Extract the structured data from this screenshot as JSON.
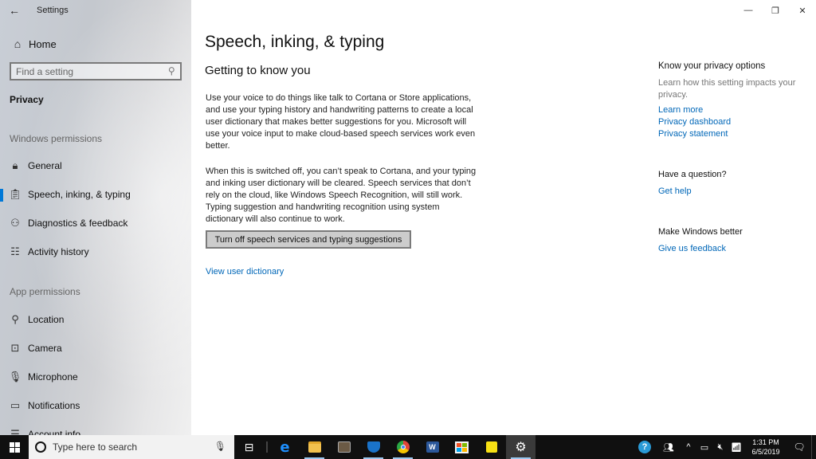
{
  "window": {
    "app_title": "Settings",
    "controls": {
      "minimize": "—",
      "restore": "❐",
      "close": "✕"
    }
  },
  "sidebar": {
    "back_icon": "←",
    "home": {
      "icon": "home-icon",
      "glyph": "⌂",
      "label": "Home"
    },
    "search": {
      "placeholder": "Find a setting",
      "value": "",
      "icon_glyph": "⚲"
    },
    "section_heading": "Privacy",
    "groups": [
      {
        "label": "Windows permissions",
        "items": [
          {
            "label": "General",
            "icon": "lock-icon",
            "glyph": "🔒︎",
            "selected": false
          },
          {
            "label": "Speech, inking, & typing",
            "icon": "clipboard-icon",
            "glyph": "📋︎",
            "selected": true
          },
          {
            "label": "Diagnostics & feedback",
            "icon": "person-feedback-icon",
            "glyph": "⚇",
            "selected": false
          },
          {
            "label": "Activity history",
            "icon": "timeline-icon",
            "glyph": "☷",
            "selected": false
          }
        ]
      },
      {
        "label": "App permissions",
        "items": [
          {
            "label": "Location",
            "icon": "location-icon",
            "glyph": "⚲",
            "selected": false
          },
          {
            "label": "Camera",
            "icon": "camera-icon",
            "glyph": "⊡",
            "selected": false
          },
          {
            "label": "Microphone",
            "icon": "microphone-icon",
            "glyph": "🎙︎",
            "selected": false
          },
          {
            "label": "Notifications",
            "icon": "notifications-icon",
            "glyph": "▭",
            "selected": false
          },
          {
            "label": "Account info",
            "icon": "account-info-icon",
            "glyph": "☰",
            "selected": false
          }
        ]
      }
    ]
  },
  "main": {
    "page_title": "Speech, inking, & typing",
    "section_title": "Getting to know you",
    "paragraphs": [
      "Use your voice to do things like talk to Cortana or Store applications, and use your typing history and handwriting patterns to create a local user dictionary that makes better suggestions for you. Microsoft will use your voice input to make cloud-based speech services work even better.",
      "When this is switched off, you can’t speak to Cortana, and your typing and inking user dictionary will be cleared. Speech services that don’t rely on the cloud, like Windows Speech Recognition, will still work. Typing suggestion and handwriting recognition using system dictionary will also continue to work."
    ],
    "turn_off_button": "Turn off speech services and typing suggestions",
    "view_dictionary_link": "View user dictionary"
  },
  "aside": {
    "privacy": {
      "heading": "Know your privacy options",
      "description": "Learn how this setting impacts your privacy.",
      "links": [
        "Learn more",
        "Privacy dashboard",
        "Privacy statement"
      ]
    },
    "question": {
      "heading": "Have a question?",
      "link": "Get help"
    },
    "better": {
      "heading": "Make Windows better",
      "link": "Give us feedback"
    }
  },
  "taskbar": {
    "search_placeholder": "Type here to search",
    "apps": [
      {
        "name": "task-view",
        "glyph": "⊟",
        "running": false,
        "active": false
      },
      {
        "name": "edge",
        "glyph": "e",
        "color": "#1e90ff",
        "running": false,
        "active": false
      },
      {
        "name": "file-explorer",
        "color": "#f2c14e",
        "running": true,
        "active": false
      },
      {
        "name": "app-generic",
        "color": "#6b5a45",
        "running": false,
        "active": false
      },
      {
        "name": "windows-defender",
        "color": "#1a73c9",
        "running": true,
        "active": false
      },
      {
        "name": "chrome",
        "color": "#e0453a",
        "running": true,
        "active": false
      },
      {
        "name": "word",
        "color": "#2b579a",
        "running": false,
        "active": false
      },
      {
        "name": "microsoft-store",
        "color": "#f3f3f3",
        "running": false,
        "active": false
      },
      {
        "name": "sticky-notes",
        "color": "#f7e014",
        "running": false,
        "active": false
      },
      {
        "name": "settings",
        "glyph": "⚙",
        "running": true,
        "active": true
      }
    ],
    "tray": {
      "help_icon": "?",
      "people_icon": "👥︎",
      "chevron": "^",
      "battery": "▭",
      "volume": "🔇︎",
      "network": "📶︎",
      "time": "1:31 PM",
      "date": "6/5/2019",
      "notification": "🗨︎"
    }
  },
  "colors": {
    "accent": "#0078d7",
    "link": "#0067b8",
    "taskbar": "#101010"
  }
}
